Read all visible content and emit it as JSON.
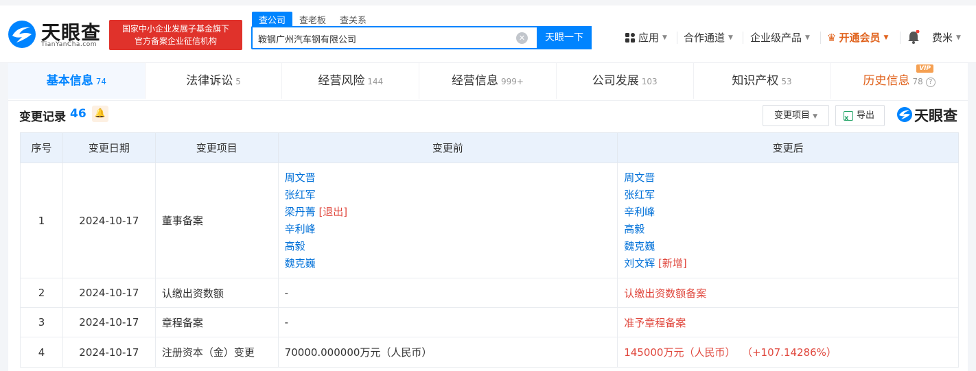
{
  "header": {
    "logo_cn": "天眼查",
    "logo_en": "TianYanCha.com",
    "banner_line1": "国家中小企业发展子基金旗下",
    "banner_line2": "官方备案企业征信机构",
    "search_tabs": [
      "查公司",
      "查老板",
      "查关系"
    ],
    "search_value": "鞍钢广州汽车钢有限公司",
    "search_button": "天眼一下",
    "nav": {
      "apps": "应用",
      "channels": "合作通道",
      "enterprise": "企业级产品",
      "vip": "开通会员",
      "user": "费米"
    }
  },
  "tabs": [
    {
      "label": "基本信息",
      "count": "74"
    },
    {
      "label": "法律诉讼",
      "count": "5"
    },
    {
      "label": "经营风险",
      "count": "144"
    },
    {
      "label": "经营信息",
      "count": "999+"
    },
    {
      "label": "公司发展",
      "count": "103"
    },
    {
      "label": "知识产权",
      "count": "53"
    },
    {
      "label": "历史信息",
      "count": "78",
      "badge": "VIP"
    }
  ],
  "section": {
    "title": "变更记录",
    "count": "46",
    "filter_label": "变更项目",
    "export_label": "导出",
    "watermark": "天眼查"
  },
  "table": {
    "headers": [
      "序号",
      "变更日期",
      "变更项目",
      "变更前",
      "变更后"
    ],
    "rows": [
      {
        "no": "1",
        "date": "2024-10-17",
        "item": "董事备案",
        "before": [
          {
            "name": "周文晋"
          },
          {
            "name": "张红军"
          },
          {
            "name": "梁丹菁",
            "tag": "[退出]"
          },
          {
            "name": "辛利峰"
          },
          {
            "name": "高毅"
          },
          {
            "name": "魏克巍"
          }
        ],
        "after": [
          {
            "name": "周文晋"
          },
          {
            "name": "张红军"
          },
          {
            "name": "辛利峰"
          },
          {
            "name": "高毅"
          },
          {
            "name": "魏克巍"
          },
          {
            "name": "刘文辉",
            "tag": "[新增]"
          }
        ]
      },
      {
        "no": "2",
        "date": "2024-10-17",
        "item": "认缴出资数额",
        "before": "-",
        "after": "认缴出资数额备案"
      },
      {
        "no": "3",
        "date": "2024-10-17",
        "item": "章程备案",
        "before": "-",
        "after": "准予章程备案"
      },
      {
        "no": "4",
        "date": "2024-10-17",
        "item": "注册资本（金）变更",
        "before": "70000.000000万元（人民币）",
        "after": "145000万元（人民币）  （+107.14286%）"
      }
    ]
  },
  "colors": {
    "brand_blue": "#0084ff",
    "banner_red": "#e0322b",
    "vip_orange": "#e0621c",
    "link_blue": "#0070d8",
    "change_red": "#e0483e"
  }
}
